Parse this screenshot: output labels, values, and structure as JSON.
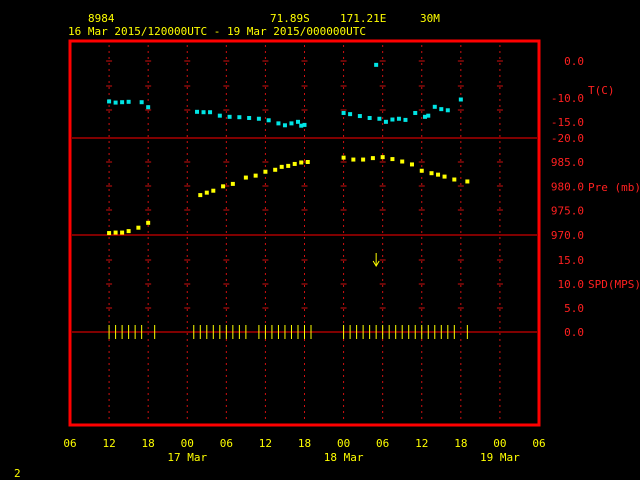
{
  "header": {
    "station": "8984",
    "lat": "71.89S",
    "lon": "171.21E",
    "height": "30M",
    "range": "16 Mar 2015/120000UTC - 19 Mar 2015/000000UTC"
  },
  "footer": {
    "page_number": "2"
  },
  "colors": {
    "frame": "#ff0000",
    "axis_text": "#ffff00",
    "panel_text": "#ff2020",
    "temp": "#00e5e5",
    "pres": "#ffff00",
    "wind": "#ffff00"
  },
  "chart_data": {
    "type": "scatter",
    "x_axis": {
      "unit": "hours since 16 Mar 06 UTC",
      "range": [
        0,
        72
      ],
      "hour_ticks": [
        "06",
        "12",
        "18",
        "00",
        "06",
        "12",
        "18",
        "00",
        "06",
        "12",
        "18",
        "00",
        "06"
      ],
      "day_labels": [
        {
          "label": "17 Mar",
          "at": 18
        },
        {
          "label": "18 Mar",
          "at": 42
        },
        {
          "label": "19 Mar",
          "at": 66
        }
      ],
      "grid_every_hours": 3
    },
    "panels": [
      {
        "label": "T(C)",
        "ticks": [
          "0.0",
          "-10.0",
          "-15.0",
          "-20.0"
        ],
        "tick_values": [
          0,
          -10,
          -15,
          -20
        ],
        "range": [
          -20,
          2.5
        ],
        "series": {
          "color": "#00e5e5",
          "points": [
            [
              6,
              -10.5
            ],
            [
              7,
              -10.8
            ],
            [
              8,
              -10.7
            ],
            [
              9,
              -10.6
            ],
            [
              11,
              -10.7
            ],
            [
              12,
              -12.0
            ],
            [
              19.5,
              -13.2
            ],
            [
              20.5,
              -13.3
            ],
            [
              21.5,
              -13.3
            ],
            [
              23,
              -14.2
            ],
            [
              24.5,
              -14.5
            ],
            [
              26,
              -14.6
            ],
            [
              27.5,
              -14.8
            ],
            [
              29,
              -15.0
            ],
            [
              30.5,
              -15.4
            ],
            [
              32,
              -16.2
            ],
            [
              33,
              -16.7
            ],
            [
              34,
              -16.2
            ],
            [
              35,
              -15.8
            ],
            [
              35.5,
              -16.8
            ],
            [
              36,
              -16.6
            ],
            [
              42,
              -13.5
            ],
            [
              43,
              -13.8
            ],
            [
              44.5,
              -14.3
            ],
            [
              46,
              -14.8
            ],
            [
              47,
              -1.0
            ],
            [
              47.5,
              -15.0
            ],
            [
              48.5,
              -15.8
            ],
            [
              49.5,
              -15.2
            ],
            [
              50.5,
              -15.0
            ],
            [
              51.5,
              -15.3
            ],
            [
              53,
              -13.5
            ],
            [
              54.5,
              -14.5
            ],
            [
              55,
              -14.2
            ],
            [
              56,
              -11.9
            ],
            [
              57,
              -12.5
            ],
            [
              58,
              -12.8
            ],
            [
              60,
              -10.0
            ]
          ]
        }
      },
      {
        "label": "Pre (mb)",
        "ticks": [
          "985.0",
          "980.0",
          "975.0",
          "970.0"
        ],
        "tick_values": [
          985,
          980,
          975,
          970
        ],
        "range": [
          968,
          990
        ],
        "series": {
          "color": "#ffff00",
          "points": [
            [
              6,
              970.4
            ],
            [
              7,
              970.5
            ],
            [
              8,
              970.5
            ],
            [
              9,
              970.8
            ],
            [
              10.5,
              971.5
            ],
            [
              12,
              972.5
            ],
            [
              20,
              978.2
            ],
            [
              21,
              978.7
            ],
            [
              22,
              979.1
            ],
            [
              23.5,
              980.0
            ],
            [
              25,
              980.5
            ],
            [
              27,
              981.8
            ],
            [
              28.5,
              982.2
            ],
            [
              30,
              983.0
            ],
            [
              31.5,
              983.4
            ],
            [
              32.5,
              984.0
            ],
            [
              33.5,
              984.2
            ],
            [
              34.5,
              984.6
            ],
            [
              35.5,
              984.9
            ],
            [
              36.5,
              985.0
            ],
            [
              42,
              985.9
            ],
            [
              43.5,
              985.5
            ],
            [
              45,
              985.5
            ],
            [
              46.5,
              985.8
            ],
            [
              48,
              986.0
            ],
            [
              49.5,
              985.6
            ],
            [
              51,
              985.1
            ],
            [
              52.5,
              984.5
            ],
            [
              54,
              983.2
            ],
            [
              55.5,
              982.7
            ],
            [
              56.5,
              982.4
            ],
            [
              57.5,
              982.0
            ],
            [
              59,
              981.4
            ],
            [
              61,
              981.0
            ]
          ]
        }
      },
      {
        "label": "SPD(MPS)",
        "ticks": [
          "15.0",
          "10.0",
          "5.0",
          "0.0"
        ],
        "tick_values": [
          15,
          10,
          5,
          0
        ],
        "range": [
          0,
          20
        ],
        "series": {
          "color": "#ffff00",
          "points": [
            [
              47,
              15.0
            ]
          ]
        },
        "calm_ticks": [
          6,
          7,
          8,
          9,
          10,
          11,
          13,
          19,
          20,
          21,
          22,
          23,
          24,
          25,
          26,
          27,
          29,
          30,
          31,
          32,
          33,
          34,
          35,
          36,
          37,
          42,
          43,
          44,
          45,
          46,
          47,
          48,
          49,
          50,
          51,
          52,
          53,
          54,
          55,
          56,
          57,
          58,
          59,
          61
        ]
      }
    ]
  }
}
